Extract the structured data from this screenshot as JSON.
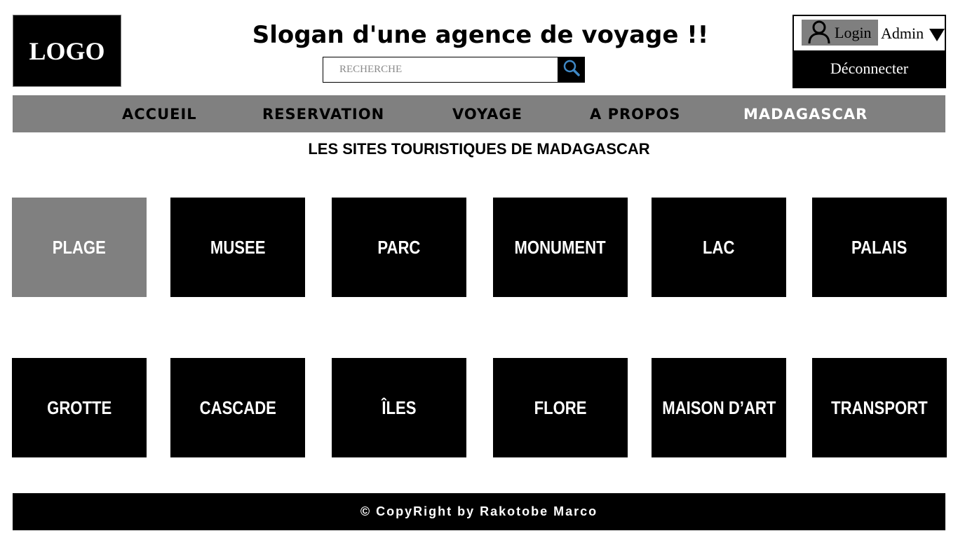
{
  "header": {
    "logo_text": "LOGO",
    "slogan": "Slogan d'une agence de voyage !!",
    "search": {
      "placeholder": "RECHERCHE",
      "value": "",
      "button_icon": "search-icon"
    },
    "account": {
      "login_label": "Login",
      "user_icon": "user-icon",
      "username": "Admin",
      "dropdown_icon": "caret-down-icon",
      "logout_label": "Déconnecter"
    }
  },
  "nav": {
    "items": [
      {
        "label": "ACCUEIL"
      },
      {
        "label": "RESERVATION"
      },
      {
        "label": "VOYAGE"
      },
      {
        "label": "A PROPOS"
      },
      {
        "label": "MADAGASCAR",
        "active": true
      }
    ]
  },
  "main": {
    "title": "LES SITES TOURISTIQUES DE MADAGASCAR",
    "tiles_row1": [
      "PLAGE",
      "MUSEE",
      "PARC",
      "MONUMENT",
      "LAC",
      "PALAIS"
    ],
    "tiles_row2": [
      "GROTTE",
      "CASCADE",
      "ÎLES",
      "FLORE",
      "MAISON D’ART",
      "TRANSPORT"
    ],
    "selected_tile": "PLAGE"
  },
  "footer": {
    "text": "© CopyRight by Rakotobe Marco"
  },
  "colors": {
    "primary": "#000000",
    "accent_gray": "#808080",
    "background": "#ffffff"
  }
}
